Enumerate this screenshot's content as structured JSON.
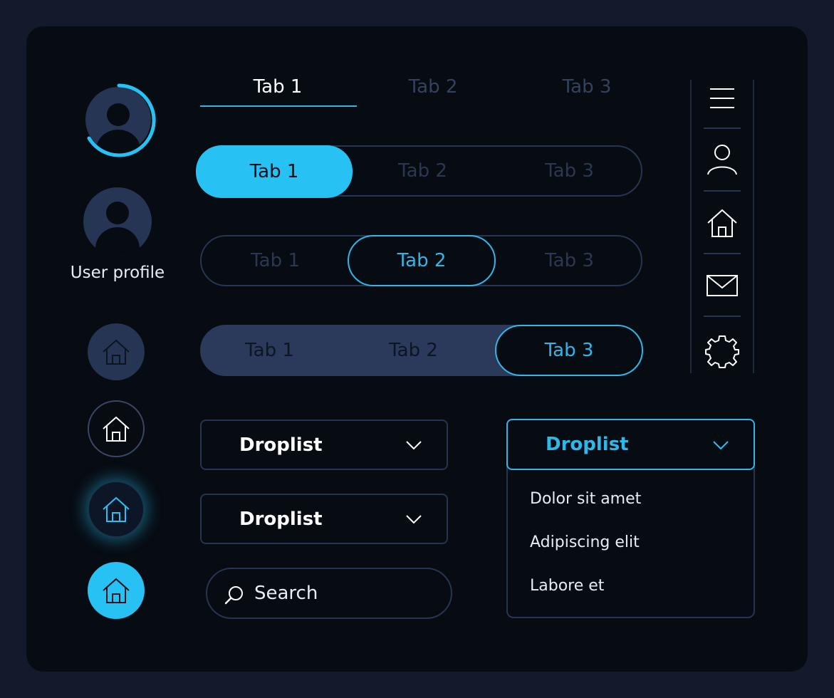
{
  "underline_tabs": [
    "Tab 1",
    "Tab 2",
    "Tab 3"
  ],
  "pill_tabs": [
    "Tab 1",
    "Tab 2",
    "Tab 3"
  ],
  "outline_tabs": [
    "Tab 1",
    "Tab 2",
    "Tab 3"
  ],
  "filled_tabs": [
    "Tab 1",
    "Tab 2",
    "Tab 3"
  ],
  "profile": {
    "label": "User profile"
  },
  "droplists": {
    "first": "Droplist",
    "second": "Droplist",
    "open": "Droplist"
  },
  "dropdown_options": [
    "Dolor sit amet",
    "Adipiscing elit",
    "Labore et"
  ],
  "search": {
    "placeholder": "Search"
  },
  "right_nav": [
    "menu-icon",
    "user-icon",
    "home-icon",
    "mail-icon",
    "gear-icon"
  ],
  "home_buttons": [
    "home-icon",
    "home-icon",
    "home-icon",
    "home-icon"
  ],
  "colors": {
    "accent": "#28c1f4",
    "panel": "#070b12",
    "background": "#121a2c",
    "muted": "#253553"
  }
}
